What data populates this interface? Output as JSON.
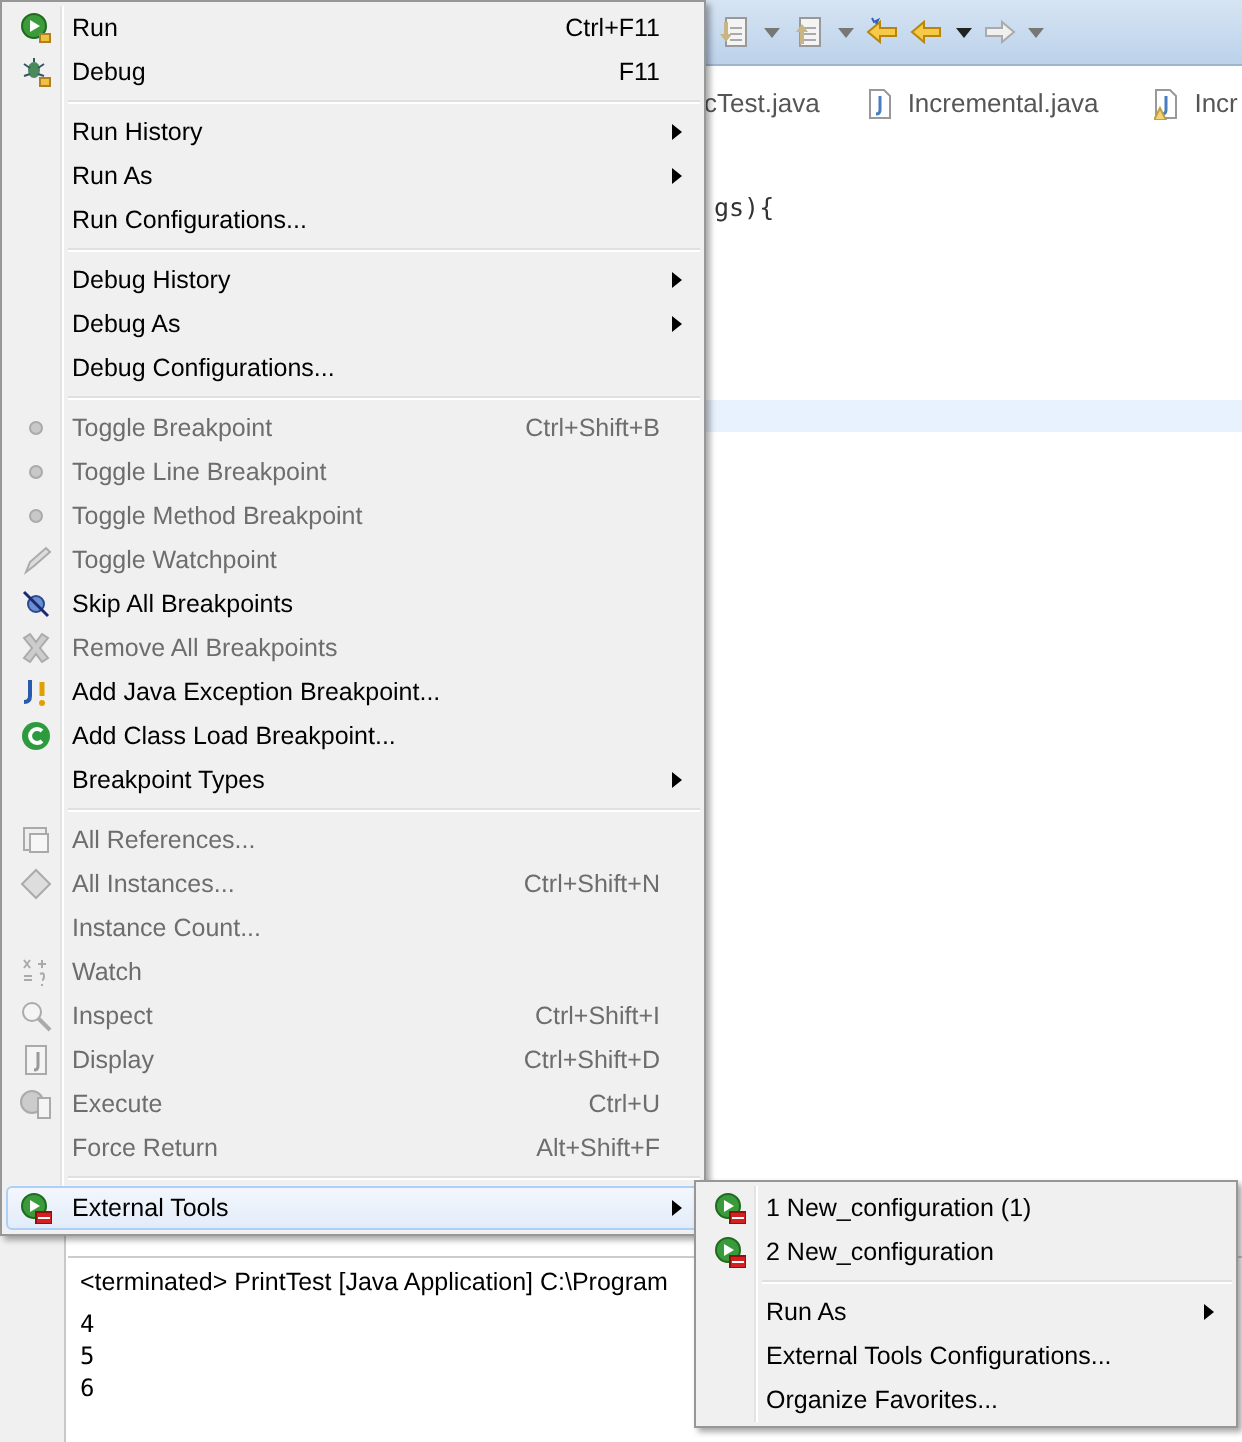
{
  "editor_tabs": [
    {
      "label": "cTest.java"
    },
    {
      "label": "Incremental.java"
    },
    {
      "label": "Incr"
    }
  ],
  "code_lines": [
    "gs){"
  ],
  "console": {
    "header": "<terminated> PrintTest [Java Application] C:\\Program",
    "lines": [
      "4",
      "5",
      "6"
    ]
  },
  "menu": {
    "sections": [
      {
        "items": [
          {
            "label": "Run",
            "shortcut": "Ctrl+F11",
            "disabled": false,
            "has_submenu": false,
            "selected": false
          },
          {
            "label": "Debug",
            "shortcut": "F11",
            "disabled": false,
            "has_submenu": false,
            "selected": false
          }
        ]
      },
      {
        "items": [
          {
            "label": "Run History",
            "disabled": false,
            "has_submenu": true,
            "selected": false
          },
          {
            "label": "Run As",
            "disabled": false,
            "has_submenu": true,
            "selected": false
          },
          {
            "label": "Run Configurations...",
            "disabled": false,
            "has_submenu": false,
            "selected": false
          }
        ]
      },
      {
        "items": [
          {
            "label": "Debug History",
            "disabled": false,
            "has_submenu": true,
            "selected": false
          },
          {
            "label": "Debug As",
            "disabled": false,
            "has_submenu": true,
            "selected": false
          },
          {
            "label": "Debug Configurations...",
            "disabled": false,
            "has_submenu": false,
            "selected": false
          }
        ]
      },
      {
        "items": [
          {
            "label": "Toggle Breakpoint",
            "shortcut": "Ctrl+Shift+B",
            "disabled": true,
            "has_submenu": false,
            "selected": false
          },
          {
            "label": "Toggle Line Breakpoint",
            "disabled": true,
            "has_submenu": false,
            "selected": false
          },
          {
            "label": "Toggle Method Breakpoint",
            "disabled": true,
            "has_submenu": false,
            "selected": false
          },
          {
            "label": "Toggle Watchpoint",
            "disabled": true,
            "has_submenu": false,
            "selected": false
          },
          {
            "label": "Skip All Breakpoints",
            "disabled": false,
            "has_submenu": false,
            "selected": false
          },
          {
            "label": "Remove All Breakpoints",
            "disabled": true,
            "has_submenu": false,
            "selected": false
          },
          {
            "label": "Add Java Exception Breakpoint...",
            "disabled": false,
            "has_submenu": false,
            "selected": false
          },
          {
            "label": "Add Class Load Breakpoint...",
            "disabled": false,
            "has_submenu": false,
            "selected": false
          },
          {
            "label": "Breakpoint Types",
            "disabled": false,
            "has_submenu": true,
            "selected": false
          }
        ]
      },
      {
        "items": [
          {
            "label": "All References...",
            "disabled": true,
            "has_submenu": false,
            "selected": false
          },
          {
            "label": "All Instances...",
            "shortcut": "Ctrl+Shift+N",
            "disabled": true,
            "has_submenu": false,
            "selected": false
          },
          {
            "label": "Instance Count...",
            "disabled": true,
            "has_submenu": false,
            "selected": false
          },
          {
            "label": "Watch",
            "disabled": true,
            "has_submenu": false,
            "selected": false
          },
          {
            "label": "Inspect",
            "shortcut": "Ctrl+Shift+I",
            "disabled": true,
            "has_submenu": false,
            "selected": false
          },
          {
            "label": "Display",
            "shortcut": "Ctrl+Shift+D",
            "disabled": true,
            "has_submenu": false,
            "selected": false
          },
          {
            "label": "Execute",
            "shortcut": "Ctrl+U",
            "disabled": true,
            "has_submenu": false,
            "selected": false
          },
          {
            "label": "Force Return",
            "shortcut": "Alt+Shift+F",
            "disabled": true,
            "has_submenu": false,
            "selected": false
          }
        ]
      },
      {
        "items": [
          {
            "label": "External Tools",
            "disabled": false,
            "has_submenu": true,
            "selected": true
          }
        ]
      }
    ]
  },
  "submenu": {
    "sections": [
      {
        "items": [
          {
            "label": "1 New_configuration (1)",
            "disabled": false,
            "has_submenu": false,
            "selected": false
          },
          {
            "label": "2 New_configuration",
            "disabled": false,
            "has_submenu": false,
            "selected": false
          }
        ]
      },
      {
        "items": [
          {
            "label": "Run As",
            "disabled": false,
            "has_submenu": true,
            "selected": false
          },
          {
            "label": "External Tools Configurations...",
            "disabled": false,
            "has_submenu": false,
            "selected": false
          },
          {
            "label": "Organize Favorites...",
            "disabled": false,
            "has_submenu": false,
            "selected": false
          }
        ]
      }
    ]
  }
}
